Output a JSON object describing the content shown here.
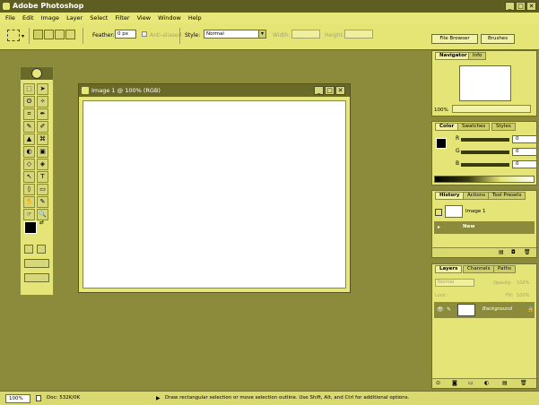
{
  "window": {
    "title": "Adobe Photoshop",
    "min": "_",
    "max": "□",
    "close": "✕"
  },
  "menu": [
    "File",
    "Edit",
    "Image",
    "Layer",
    "Select",
    "Filter",
    "View",
    "Window",
    "Help"
  ],
  "options": {
    "feather_label": "Feather:",
    "feather_value": "0 px",
    "antialias_label": "Anti-aliased",
    "style_label": "Style:",
    "style_value": "Normal",
    "width_label": "Width:",
    "height_label": "Height:",
    "file_browser": "File Browser",
    "brushes": "Brushes"
  },
  "document": {
    "title": "Image 1 @ 100% (RGB)"
  },
  "navigator": {
    "tabs": [
      "Navigator",
      "Info"
    ],
    "zoom": "100%"
  },
  "color": {
    "tabs": [
      "Color",
      "Swatches",
      "Styles"
    ],
    "channels": [
      {
        "label": "R",
        "value": "0"
      },
      {
        "label": "G",
        "value": "0"
      },
      {
        "label": "B",
        "value": "0"
      }
    ]
  },
  "history": {
    "tabs": [
      "History",
      "Actions",
      "Tool Presets"
    ],
    "snapshot": "Image 1",
    "item": "New"
  },
  "layers": {
    "tabs": [
      "Layers",
      "Channels",
      "Paths"
    ],
    "blend_mode": "Normal",
    "opacity_label": "Opacity:",
    "opacity_value": "100%",
    "lock_label": "Lock:",
    "fill_label": "Fill:",
    "fill_value": "100%",
    "layer_name": "Background"
  },
  "status": {
    "zoom": "100%",
    "doc": "Doc: 532K/0K",
    "hint": "Draw rectangular selection or move selection outline. Use Shift, Alt, and Ctrl for additional options."
  },
  "tools": [
    "⬚",
    "➤",
    "ʘ",
    "✧",
    "⌗",
    "✒",
    "✎",
    "✐",
    "▲",
    "⌘",
    "◐",
    "▣",
    "◇",
    "◈",
    "↖",
    "T",
    "◊",
    "▭",
    "✋",
    "✎",
    "☞",
    "🔍"
  ]
}
